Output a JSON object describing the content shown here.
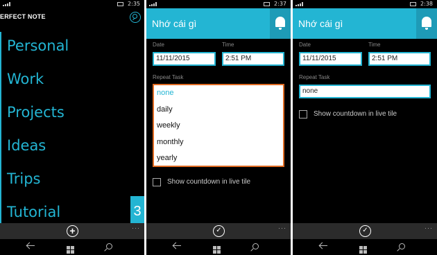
{
  "status": {
    "panel1_time": "2:35",
    "panel2_time": "2:37",
    "panel3_time": "2:38"
  },
  "home": {
    "app_title": "ERFECT NOTE",
    "categories": [
      "Personal",
      "Work",
      "Projects",
      "Ideas",
      "Trips",
      "Tutorial"
    ],
    "badge_count": "3",
    "add_glyph": "+"
  },
  "reminder": {
    "title": "Nhớ cái gì",
    "date_label": "Date",
    "date_value": "11/11/2015",
    "time_label": "Time",
    "time_value": "2:51 PM",
    "repeat_label": "Repeat Task",
    "repeat_options": [
      "none",
      "daily",
      "weekly",
      "monthly",
      "yearly"
    ],
    "repeat_selected": "none",
    "countdown_label": "Show countdown in live tile"
  },
  "appbar": {
    "more": "···",
    "confirm_glyph": "✓"
  },
  "icons": {
    "search": "search-icon",
    "add": "add-icon",
    "bell": "bell-icon",
    "check": "check-icon",
    "back": "back-icon",
    "windows": "windows-logo-icon",
    "find": "search-icon"
  },
  "colors": {
    "accent": "#23b5d3",
    "header_dark": "#1e9bb7",
    "dropdown_border": "#e06b22",
    "background": "#000000",
    "appbar": "#2b2b2b"
  }
}
